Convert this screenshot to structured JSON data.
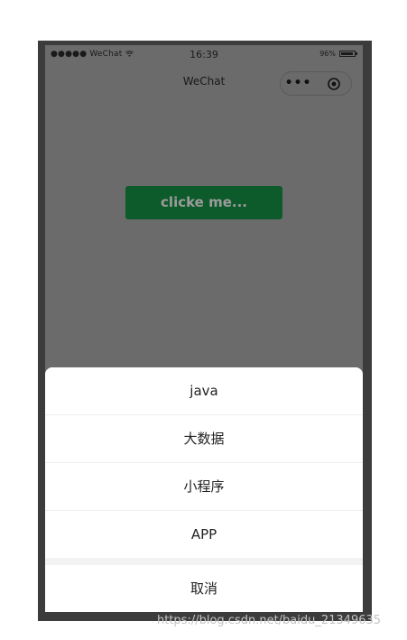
{
  "status_bar": {
    "carrier": "●●●●● WeChat",
    "time": "16:39",
    "battery_percent": "96%",
    "battery_level": 0.96
  },
  "nav_bar": {
    "title": "WeChat",
    "more_glyph": "•••"
  },
  "main": {
    "button_label": "clicke me..."
  },
  "action_sheet": {
    "items": [
      "java",
      "大数据",
      "小程序",
      "APP"
    ],
    "cancel_label": "取消"
  },
  "watermark": "https://blog.csdn.net/baidu_21349635",
  "colors": {
    "overlay": "#6b6b6b",
    "button_green": "#0d5a2a",
    "sheet_bg": "#ffffff"
  },
  "icons": [
    "wifi-icon",
    "battery-icon",
    "more-dots-icon",
    "capsule-close-icon"
  ]
}
